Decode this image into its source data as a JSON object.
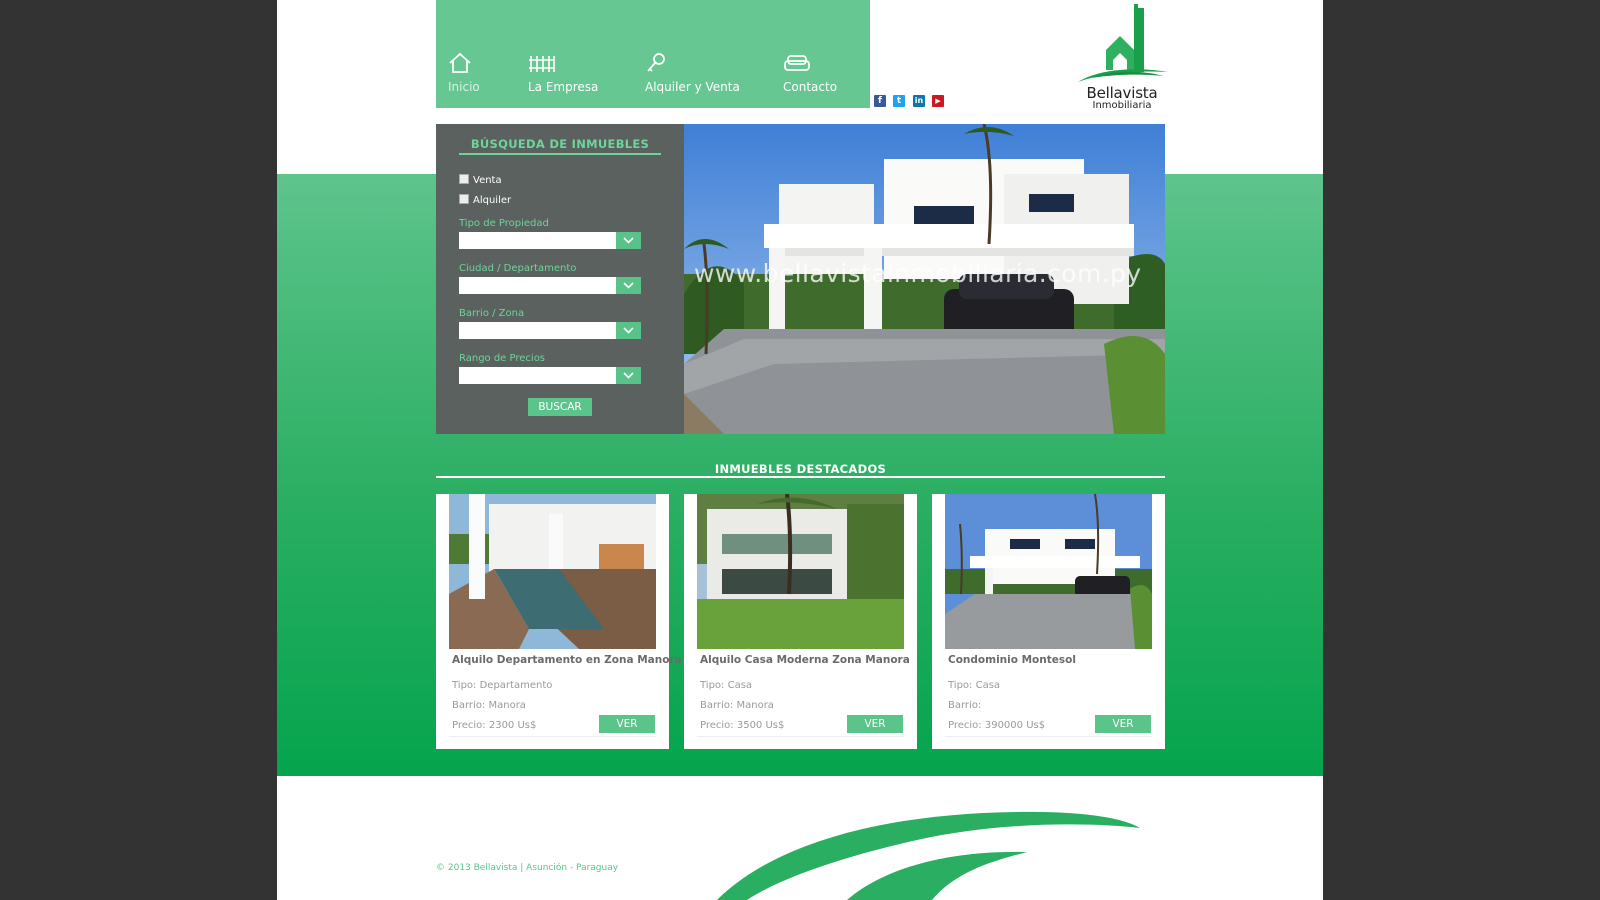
{
  "nav": {
    "items": [
      {
        "label": "Inicio",
        "icon": "home-icon"
      },
      {
        "label": "La Empresa",
        "icon": "fence-icon"
      },
      {
        "label": "Alquiler y Venta",
        "icon": "key-icon"
      },
      {
        "label": "Contacto",
        "icon": "sofa-icon"
      }
    ]
  },
  "social": [
    {
      "name": "facebook",
      "glyph": "f",
      "color": "#3b5998"
    },
    {
      "name": "twitter",
      "glyph": "t",
      "color": "#1da1f2"
    },
    {
      "name": "linkedin",
      "glyph": "in",
      "color": "#0e76a8"
    },
    {
      "name": "youtube",
      "glyph": "▶",
      "color": "#cc181e"
    }
  ],
  "logo": {
    "name": "Bellavista",
    "sub": "Inmobiliaria"
  },
  "search": {
    "title": "BÚSQUEDA DE INMUEBLES",
    "check_venta": "Venta",
    "check_alquiler": "Alquiler",
    "label_tipo": "Tipo de Propiedad",
    "label_ciudad": "Ciudad / Departamento",
    "label_barrio": "Barrio / Zona",
    "label_rango": "Rango de Precios",
    "button": "BUSCAR"
  },
  "hero": {
    "watermark": "www.bellavistainmobiliaria.com.py"
  },
  "featured": {
    "title": "INMUEBLES DESTACADOS",
    "cards": [
      {
        "title": "Alquilo Departamento en Zona Manora",
        "tipo": "Tipo: Departamento",
        "barrio": "Barrio: Manora",
        "precio": "Precio: 2300 Us$",
        "button": "VER"
      },
      {
        "title": "Alquilo Casa Moderna Zona Manora",
        "tipo": "Tipo: Casa",
        "barrio": "Barrio: Manora",
        "precio": "Precio: 3500 Us$",
        "button": "VER"
      },
      {
        "title": "Condominio Montesol",
        "tipo": "Tipo: Casa",
        "barrio": "Barrio:",
        "precio": "Precio: 390000 Us$",
        "button": "VER"
      }
    ]
  },
  "footer": {
    "text": "© 2013 Bellavista | Asunción - Paraguay"
  },
  "colors": {
    "accent": "#5bc48b",
    "nav_bg": "#66c792",
    "panel_bg": "#5b615f",
    "outer_bg": "#333333"
  }
}
